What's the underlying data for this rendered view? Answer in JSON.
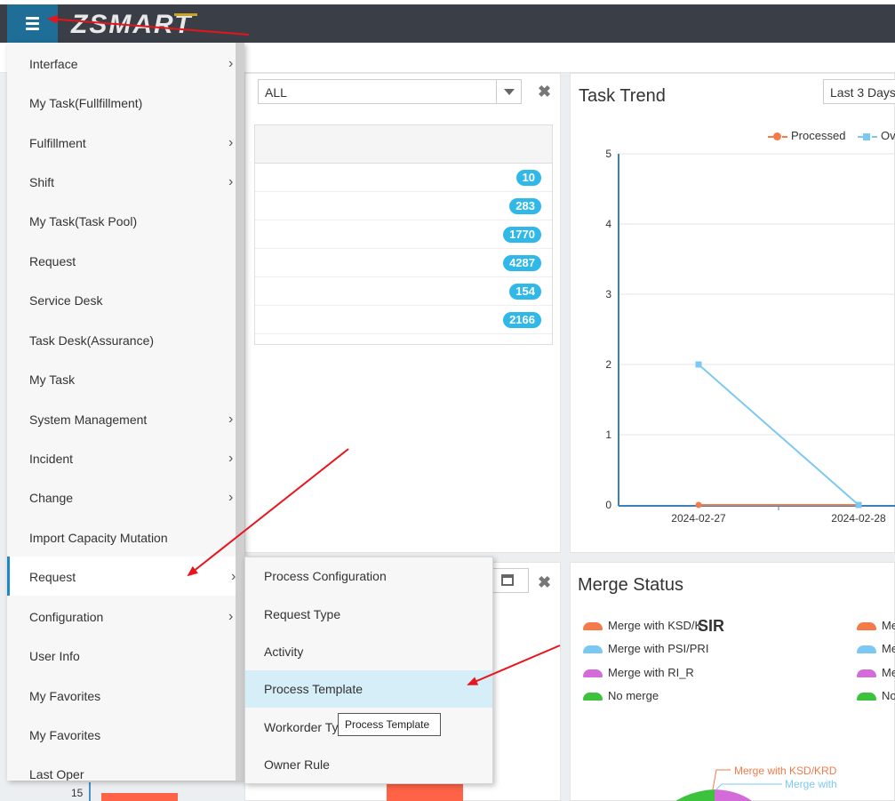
{
  "header": {
    "logo_text": "ZSMART"
  },
  "side_menu": {
    "items": [
      {
        "label": "Interface",
        "has_submenu": true
      },
      {
        "label": "My Task(Fullfillment)",
        "has_submenu": false
      },
      {
        "label": "Fulfillment",
        "has_submenu": true
      },
      {
        "label": "Shift",
        "has_submenu": true
      },
      {
        "label": "My Task(Task Pool)",
        "has_submenu": false
      },
      {
        "label": "Request",
        "has_submenu": false
      },
      {
        "label": "Service Desk",
        "has_submenu": false
      },
      {
        "label": "Task Desk(Assurance)",
        "has_submenu": false
      },
      {
        "label": "My Task",
        "has_submenu": false
      },
      {
        "label": "System Management",
        "has_submenu": true
      },
      {
        "label": "Incident",
        "has_submenu": true
      },
      {
        "label": "Change",
        "has_submenu": true
      },
      {
        "label": "Import Capacity Mutation",
        "has_submenu": false
      },
      {
        "label": "Request",
        "has_submenu": true,
        "active": true
      },
      {
        "label": "Configuration",
        "has_submenu": true
      },
      {
        "label": "User Info",
        "has_submenu": false
      },
      {
        "label": "My Favorites",
        "has_submenu": false
      },
      {
        "label": "My Favorites",
        "has_submenu": false
      },
      {
        "label": "Last Oper",
        "has_submenu": false
      }
    ]
  },
  "submenu": {
    "items": [
      {
        "label": "Process Configuration"
      },
      {
        "label": "Request Type"
      },
      {
        "label": "Activity"
      },
      {
        "label": "Process Template",
        "hovered": true
      },
      {
        "label": "Workorder Ty"
      },
      {
        "label": "Owner Rule"
      }
    ],
    "tooltip": "Process Template"
  },
  "stats_panel": {
    "filter_value": "ALL",
    "badges": [
      "10",
      "283",
      "1770",
      "4287",
      "154",
      "2166"
    ]
  },
  "task_trend": {
    "title": "Task Trend",
    "range_value": "Last 3 Days",
    "legend": [
      {
        "name": "Processed",
        "color": "#f47a4a"
      },
      {
        "name": "Ov",
        "color": "#7dc8f2"
      }
    ]
  },
  "chart_data": {
    "type": "line",
    "x": [
      "2024-02-27",
      "2024-02-28"
    ],
    "series": [
      {
        "name": "Processed",
        "values": [
          0,
          0
        ],
        "color": "#f47a4a"
      },
      {
        "name": "Ov",
        "values": [
          2,
          0
        ],
        "color": "#7dc8f2"
      }
    ],
    "yticks": [
      "0",
      "1",
      "2",
      "3",
      "4",
      "5"
    ],
    "ylim": [
      0,
      5
    ]
  },
  "merge_status": {
    "title": "Merge Status",
    "overlay_text": "SIR",
    "legend_left": [
      {
        "label": "Merge with KSD/K",
        "color": "#f47a4a"
      },
      {
        "label": "Merge with PSI/PRI",
        "color": "#7dc8f2"
      },
      {
        "label": "Merge with RI_R",
        "color": "#d36bd8"
      },
      {
        "label": "No merge",
        "color": "#3cc23c"
      }
    ],
    "legend_right": [
      {
        "label": "Me",
        "color": "#f47a4a"
      },
      {
        "label": "Me",
        "color": "#7dc8f2"
      },
      {
        "label": "Me",
        "color": "#d36bd8"
      },
      {
        "label": "No",
        "color": "#3cc23c"
      }
    ],
    "pie_labels": [
      {
        "text": "Merge with KSD/KRD",
        "color": "#f47a4a"
      },
      {
        "text": "Merge with",
        "color": "#7dc8f2"
      }
    ]
  },
  "bottom_chart": {
    "ytick": "15",
    "bar_label": "15"
  }
}
